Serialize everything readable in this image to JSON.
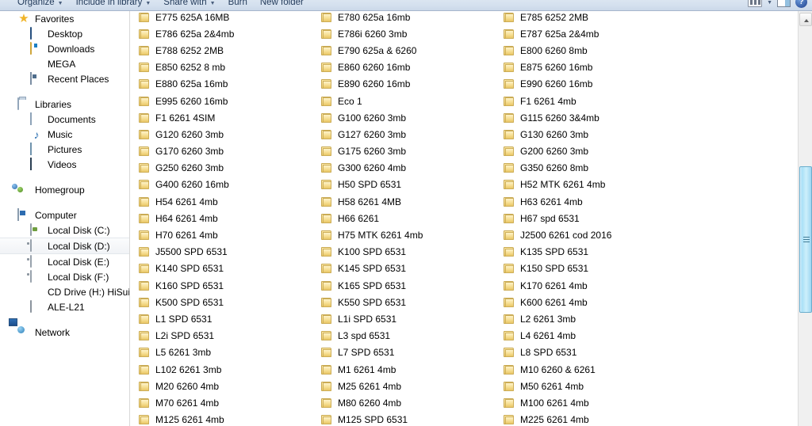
{
  "toolbar": {
    "buttons": [
      {
        "label": "Organize",
        "caret": true
      },
      {
        "label": "Include in library",
        "caret": true
      },
      {
        "label": "Share with",
        "caret": true
      },
      {
        "label": "Burn",
        "caret": false
      },
      {
        "label": "New folder",
        "caret": false
      }
    ],
    "right_icons": [
      {
        "name": "change-view-icon"
      },
      {
        "name": "preview-pane-icon"
      },
      {
        "name": "help-icon"
      }
    ]
  },
  "sidebar": {
    "groups": [
      {
        "items": [
          {
            "label": "Favorites",
            "icon": "star-icon",
            "level": 1,
            "selected": false
          },
          {
            "label": "Desktop",
            "icon": "desktop-icon",
            "level": 2,
            "selected": false
          },
          {
            "label": "Downloads",
            "icon": "downloads-icon",
            "level": 2,
            "selected": false
          },
          {
            "label": "MEGA",
            "icon": "mega-icon",
            "level": 2,
            "selected": false
          },
          {
            "label": "Recent Places",
            "icon": "recent-places-icon",
            "level": 2,
            "selected": false
          }
        ]
      },
      {
        "items": [
          {
            "label": "Libraries",
            "icon": "libraries-icon",
            "level": 1,
            "selected": false
          },
          {
            "label": "Documents",
            "icon": "documents-icon",
            "level": 2,
            "selected": false
          },
          {
            "label": "Music",
            "icon": "music-icon",
            "level": 2,
            "selected": false
          },
          {
            "label": "Pictures",
            "icon": "pictures-icon",
            "level": 2,
            "selected": false
          },
          {
            "label": "Videos",
            "icon": "videos-icon",
            "level": 2,
            "selected": false
          }
        ]
      },
      {
        "items": [
          {
            "label": "Homegroup",
            "icon": "homegroup-icon",
            "level": 1,
            "selected": false
          }
        ]
      },
      {
        "items": [
          {
            "label": "Computer",
            "icon": "computer-icon",
            "level": 1,
            "selected": false
          },
          {
            "label": "Local Disk (C:)",
            "icon": "system-disk-icon",
            "level": 2,
            "selected": false
          },
          {
            "label": "Local Disk (D:)",
            "icon": "disk-icon",
            "level": 2,
            "selected": true
          },
          {
            "label": "Local Disk (E:)",
            "icon": "disk-icon",
            "level": 2,
            "selected": false
          },
          {
            "label": "Local Disk (F:)",
            "icon": "disk-icon",
            "level": 2,
            "selected": false
          },
          {
            "label": "CD Drive (H:) HiSuite",
            "icon": "cd-drive-icon",
            "level": 2,
            "selected": false
          },
          {
            "label": "ALE-L21",
            "icon": "phone-icon",
            "level": 2,
            "selected": false
          }
        ]
      },
      {
        "items": [
          {
            "label": "Network",
            "icon": "network-icon",
            "level": 1,
            "selected": false
          }
        ]
      }
    ]
  },
  "file_list": {
    "columns": [
      [
        "E775 625A 16MB",
        "E786 625a 2&4mb",
        "E788 6252 2MB",
        "E850 6252 8 mb",
        "E880 625a 16mb",
        "E995 6260 16mb",
        "F1 6261 4SIM",
        "G120 6260 3mb",
        "G170 6260 3mb",
        "G250 6260 3mb",
        "G400 6260 16mb",
        "H54 6261 4mb",
        "H64 6261 4mb",
        "H70 6261 4mb",
        "J5500 SPD 6531",
        "K140 SPD 6531",
        "K160 SPD 6531",
        "K500 SPD 6531",
        "L1 SPD 6531",
        "L2i SPD 6531",
        "L5 6261 3mb",
        "L102 6261 3mb",
        "M20 6260 4mb",
        "M70 6261 4mb",
        "M125 6261 4mb"
      ],
      [
        "E780 625a 16mb",
        "E786i 6260 3mb",
        "E790 625a & 6260",
        "E860 6260 16mb",
        "E890 6260 16mb",
        "Eco 1",
        "G100 6260 3mb",
        "G127 6260 3mb",
        "G175 6260 3mb",
        "G300 6260 4mb",
        "H50 SPD 6531",
        "H58 6261 4MB",
        "H66 6261",
        "H75 MTK 6261 4mb",
        "K100 SPD 6531",
        "K145 SPD 6531",
        "K165 SPD 6531",
        "K550 SPD 6531",
        "L1i SPD 6531",
        "L3 spd 6531",
        "L7 SPD 6531",
        "M1 6261 4mb",
        "M25 6261 4mb",
        "M80 6260 4mb",
        "M125 SPD 6531"
      ],
      [
        "E785 6252 2MB",
        "E787 625a 2&4mb",
        "E800 6260 8mb",
        "E875 6260 16mb",
        "E990 6260 16mb",
        "F1 6261 4mb",
        "G115 6260 3&4mb",
        "G130 6260 3mb",
        "G200 6260 3mb",
        "G350 6260 8mb",
        "H52 MTK 6261 4mb",
        "H63 6261 4mb",
        "H67 spd 6531",
        "J2500 6261 cod 2016",
        "K135 SPD 6531",
        "K150 SPD 6531",
        "K170 6261 4mb",
        "K600 6261 4mb",
        "L2 6261 3mb",
        "L4 6261 4mb",
        "L8 SPD 6531",
        "M10 6260 & 6261",
        "M50 6261 4mb",
        "M100 6261 4mb",
        "M225 6261 4mb"
      ]
    ]
  },
  "scrollbar": {
    "up_arrow_name": "scroll-up-arrow",
    "thumb_name": "vertical-scroll-thumb"
  },
  "colors": {
    "toolbar_bg": "#d3dfee",
    "folder_gold": "#f7dd92",
    "selection_bg": "#f1f3f6",
    "scroll_thumb": "#a9e0f7"
  }
}
